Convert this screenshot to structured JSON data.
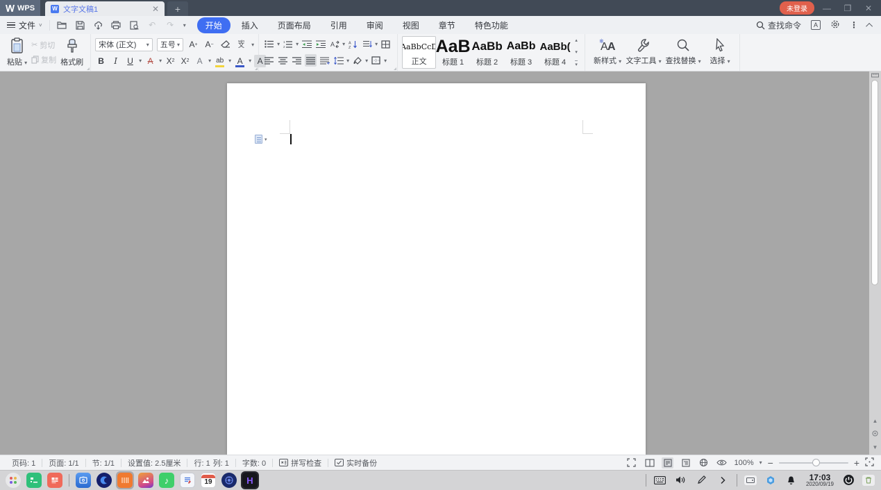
{
  "titlebar": {
    "logo": "WPS",
    "tab_title": "文字文稿1",
    "login_badge": "未登录",
    "minimize_glyph": "—",
    "restore_glyph": "❐",
    "close_glyph": "✕",
    "tab_close_glyph": "✕",
    "new_tab_glyph": "+"
  },
  "menubar": {
    "file_label": "文件",
    "tabs": [
      "开始",
      "插入",
      "页面布局",
      "引用",
      "审阅",
      "视图",
      "章节",
      "特色功能"
    ],
    "active_tab": "开始",
    "search_label": "查找命令",
    "accent_color": "#3f6ef2"
  },
  "ribbon": {
    "paste_label": "粘贴",
    "cut_label": "剪切",
    "copy_label": "复制",
    "format_painter_label": "格式刷",
    "font_name": "宋体 (正文)",
    "font_size": "五号",
    "styles": [
      {
        "sample": "AaBbCcD",
        "label": "正文"
      },
      {
        "sample": "AaB",
        "label": "标题 1"
      },
      {
        "sample": "AaBb",
        "label": "标题 2"
      },
      {
        "sample": "AaBb",
        "label": "标题 3"
      },
      {
        "sample": "AaBb(",
        "label": "标题 4"
      }
    ],
    "new_style_label": "新样式",
    "text_tool_label": "文字工具",
    "find_replace_label": "查找替换",
    "select_label": "选择",
    "icons": {
      "bold": "B",
      "italic": "I",
      "underline": "U",
      "strikethrough": "A",
      "superscript_base": "X",
      "superscript_exp": "2",
      "subscript_base": "X",
      "subscript_exp": "2",
      "text_effects": "A",
      "highlight": "ab",
      "font_color": "A",
      "char_shading": "A",
      "grow_font": "A",
      "shrink_font": "A",
      "pinyin_guide": "文",
      "undo": "↶",
      "redo": "↷",
      "cut": "✂",
      "highlight_bar_color": "#f2d43c",
      "font_color_bar_color": "#3a57c8"
    }
  },
  "statusbar": {
    "page_number": "页码: 1",
    "page_count": "页面: 1/1",
    "section": "节: 1/1",
    "setting_value": "设置值: 2.5厘米",
    "line": "行: 1",
    "column": "列: 1",
    "word_count": "字数: 0",
    "spell_check": "拼写检查",
    "realtime_backup": "实时备份",
    "zoom_level": "100%"
  },
  "taskbar": {
    "time": "17:03",
    "date": "2020/09/19",
    "music_glyph": "♪",
    "calendar_day": "19",
    "h_app_glyph": "H"
  }
}
